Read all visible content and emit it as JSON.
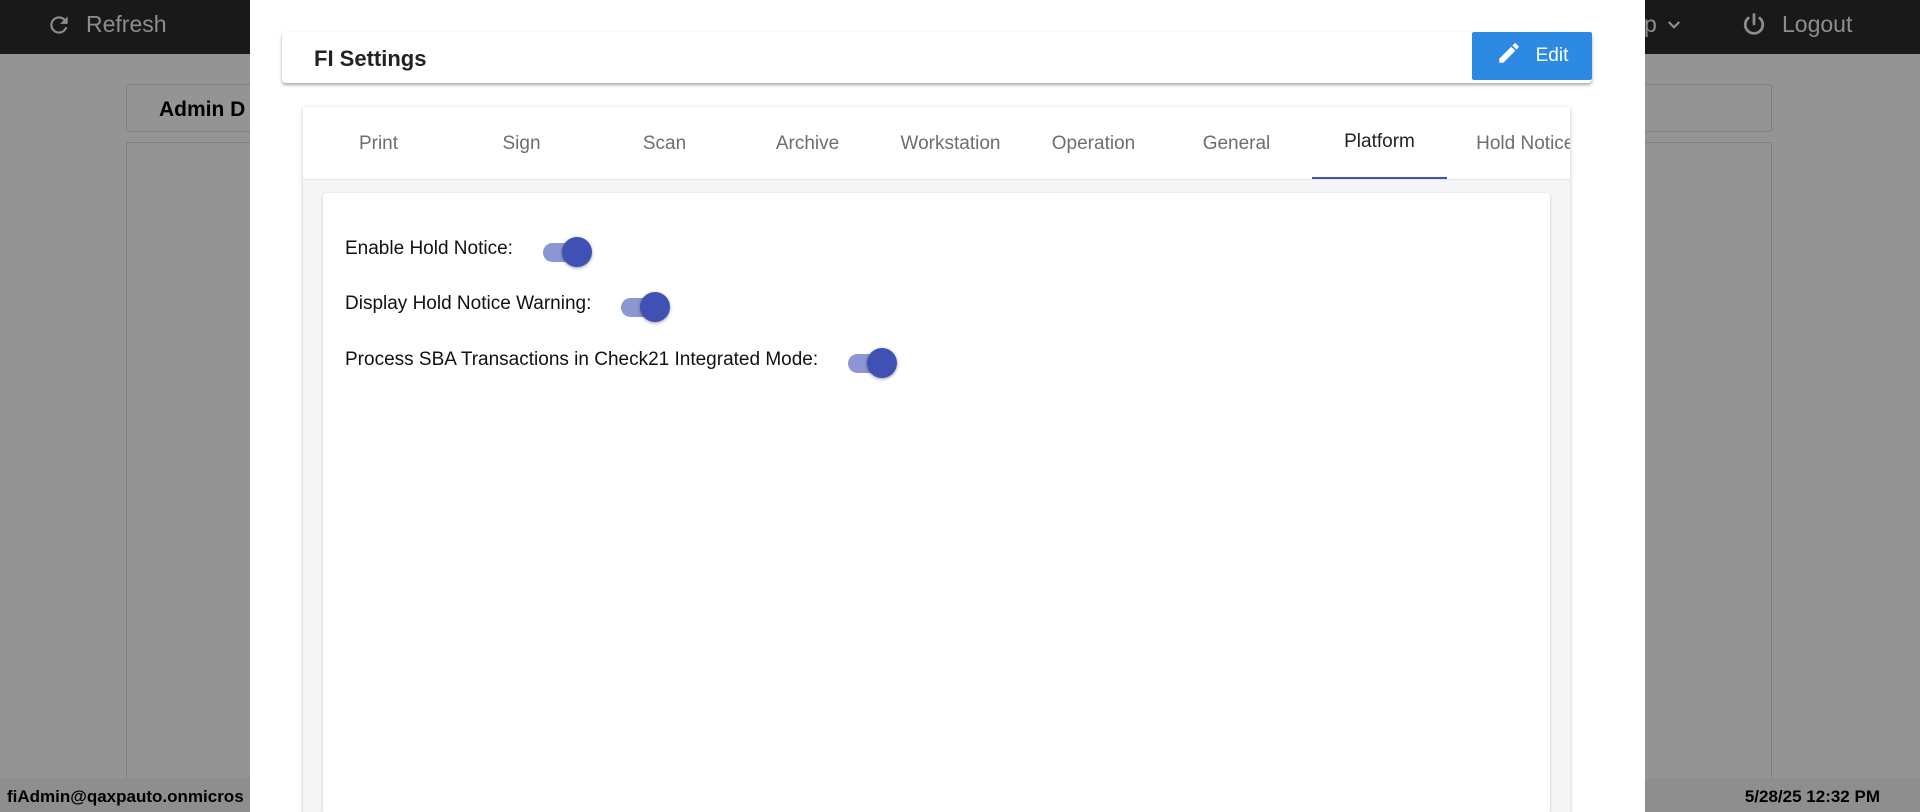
{
  "topbar": {
    "refresh_label": "Refresh",
    "help_label_partial": "p",
    "logout_label": "Logout"
  },
  "background": {
    "title_partial": "Admin D"
  },
  "statusbar": {
    "user": "fiAdmin@qaxpauto.onmicros",
    "datetime": "5/28/25 12:32 PM"
  },
  "modal": {
    "title": "FI Settings",
    "edit_label": "Edit",
    "tabs": [
      {
        "label": "Print"
      },
      {
        "label": "Sign"
      },
      {
        "label": "Scan"
      },
      {
        "label": "Archive"
      },
      {
        "label": "Workstation"
      },
      {
        "label": "Operation"
      },
      {
        "label": "General"
      },
      {
        "label": "Platform"
      },
      {
        "label": "Hold Notices"
      }
    ],
    "active_tab": "Platform",
    "settings": [
      {
        "label": "Enable Hold Notice:",
        "enabled": true
      },
      {
        "label": "Display Hold Notice Warning:",
        "enabled": true
      },
      {
        "label": "Process SBA Transactions in Check21 Integrated Mode:",
        "enabled": true
      }
    ]
  },
  "colors": {
    "accent": "#3f51b5",
    "edit_button": "#2d8ae3",
    "topbar": "#2b2b2b"
  },
  "icons": {
    "refresh": "refresh-icon",
    "chevron": "chevron-down-icon",
    "logout": "power-icon",
    "edit": "pencil-icon"
  }
}
